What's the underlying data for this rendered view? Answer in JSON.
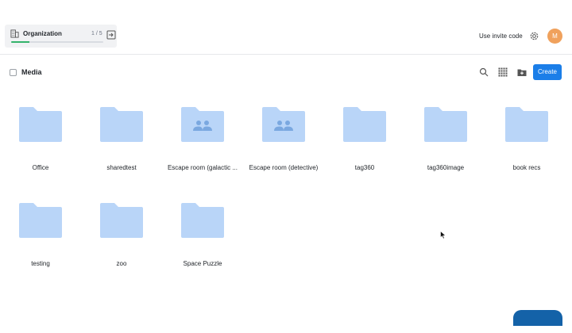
{
  "org": {
    "name": "Organization",
    "step": "1 / 5",
    "progress": 0.2
  },
  "header": {
    "invite_label": "Use invite code",
    "avatar_initial": "M"
  },
  "toolbar": {
    "title": "Media",
    "create_label": "Create"
  },
  "folders": [
    {
      "label": "Office",
      "shared": false
    },
    {
      "label": "sharedtest",
      "shared": false
    },
    {
      "label": "Escape room (galactic ...",
      "shared": true
    },
    {
      "label": "Escape room (detective)",
      "shared": true
    },
    {
      "label": "tag360",
      "shared": false
    },
    {
      "label": "tag360image",
      "shared": false
    },
    {
      "label": "book recs",
      "shared": false
    },
    {
      "label": "testing",
      "shared": false
    },
    {
      "label": "zoo",
      "shared": false
    },
    {
      "label": "Space Puzzle",
      "shared": false
    }
  ],
  "colors": {
    "folder": "#b9d5f8",
    "folder_shared_icon": "#7aa8e0",
    "accent": "#1b7ee8"
  }
}
